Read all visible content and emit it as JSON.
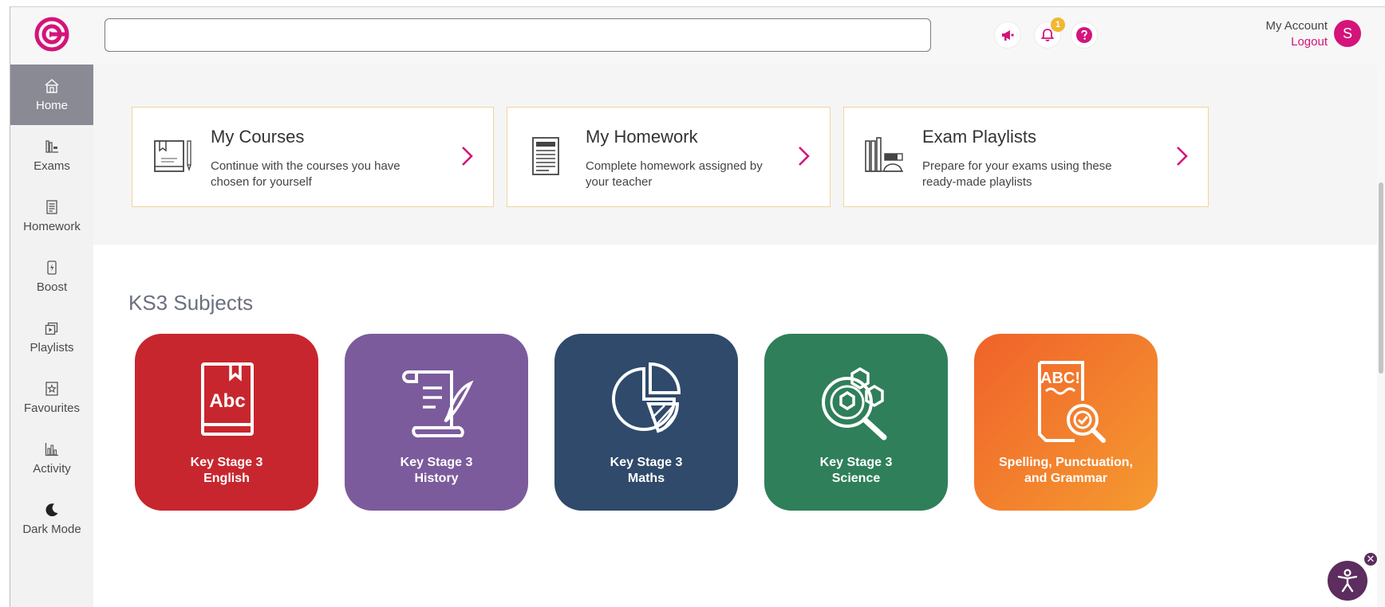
{
  "header": {
    "search": {
      "value": "",
      "placeholder": ""
    },
    "notification_count": "1",
    "account_label": "My Account",
    "logout_label": "Logout",
    "avatar_initial": "S"
  },
  "sidebar": {
    "items": [
      {
        "label": "Home",
        "icon": "home-icon",
        "active": true
      },
      {
        "label": "Exams",
        "icon": "exams-icon"
      },
      {
        "label": "Homework",
        "icon": "homework-icon"
      },
      {
        "label": "Boost",
        "icon": "boost-icon"
      },
      {
        "label": "Playlists",
        "icon": "playlists-icon"
      },
      {
        "label": "Favourites",
        "icon": "favourites-icon"
      },
      {
        "label": "Activity",
        "icon": "activity-icon"
      },
      {
        "label": "Dark Mode",
        "icon": "moon-icon"
      }
    ]
  },
  "cards": [
    {
      "title": "My Courses",
      "description": "Continue with the courses you have chosen for yourself",
      "icon": "courses-book-icon"
    },
    {
      "title": "My Homework",
      "description": "Complete homework assigned by your teacher",
      "icon": "homework-document-icon"
    },
    {
      "title": "Exam Playlists",
      "description": "Prepare for your exams using these ready-made playlists",
      "icon": "exam-playlists-icon"
    }
  ],
  "subjects": {
    "title": "KS3 Subjects",
    "tiles": [
      {
        "line1": "Key Stage 3",
        "line2": "English",
        "color": "#c8262e",
        "icon": "abc-book-icon"
      },
      {
        "line1": "Key Stage 3",
        "line2": "History",
        "color": "#7b5b9c",
        "icon": "scroll-quill-icon"
      },
      {
        "line1": "Key Stage 3",
        "line2": "Maths",
        "color": "#2f4a6b",
        "icon": "pie-chart-icon"
      },
      {
        "line1": "Key Stage 3",
        "line2": "Science",
        "color": "#2f7f5a",
        "icon": "molecule-magnifier-icon"
      },
      {
        "line1": "Spelling, Punctuation,",
        "line2": "and Grammar",
        "color": "#f07a2a",
        "icon": "abc-page-magnifier-icon"
      }
    ]
  },
  "colors": {
    "brand": "#d4147a",
    "sidebar_active": "#8a8a95",
    "card_border": "#f1d49a",
    "badge": "#f2b632",
    "a11y": "#5c2d5e"
  }
}
